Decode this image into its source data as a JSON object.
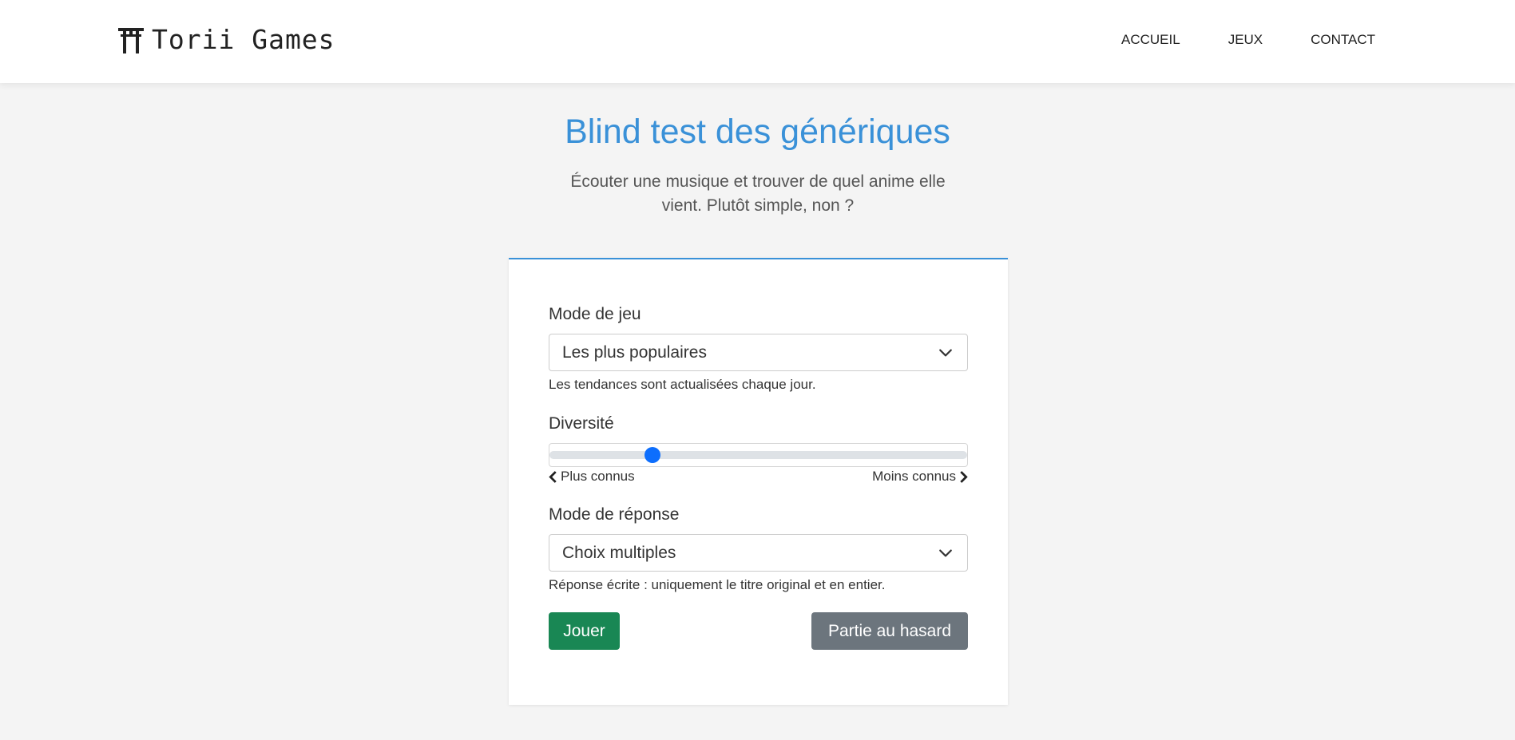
{
  "header": {
    "brand_name": "Torii Games",
    "brand_icon": "torii-gate-icon",
    "nav": [
      {
        "label": "ACCUEIL"
      },
      {
        "label": "JEUX"
      },
      {
        "label": "CONTACT"
      }
    ]
  },
  "hero": {
    "title": "Blind test des génériques",
    "subtitle": "Écouter une musique et trouver de quel anime elle vient. Plutôt simple, non ?"
  },
  "form": {
    "game_mode": {
      "label": "Mode de jeu",
      "value": "Les plus populaires",
      "help": "Les tendances sont actualisées chaque jour."
    },
    "diversity": {
      "label": "Diversité",
      "value": 0.235,
      "min_label": "Plus connus",
      "max_label": "Moins connus"
    },
    "answer_mode": {
      "label": "Mode de réponse",
      "value": "Choix multiples",
      "help": "Réponse écrite : uniquement le titre original et en entier."
    },
    "play_button": "Jouer",
    "random_button": "Partie au hasard"
  },
  "colors": {
    "accent": "#3a91d8",
    "play": "#198754",
    "random": "#6c757d",
    "slider": "#0d6efd"
  }
}
